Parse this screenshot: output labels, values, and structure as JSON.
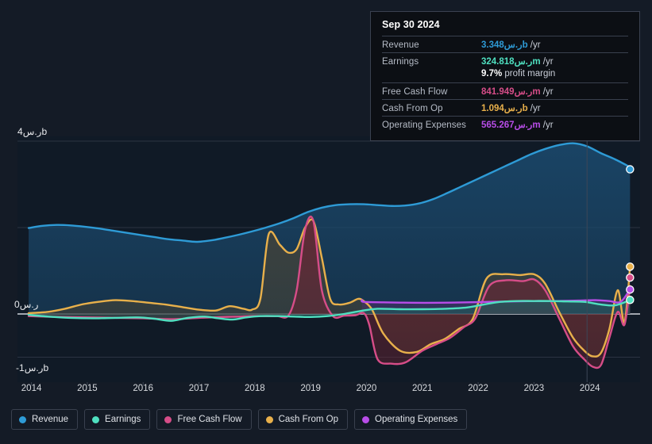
{
  "chart_data": {
    "type": "area",
    "title": "",
    "xlabel": "",
    "ylabel": "",
    "currency_symbol": "ر.س",
    "grid": true,
    "legend_position": "bottom",
    "xlim": [
      2013.75,
      2024.9
    ],
    "ylim": [
      -1.45,
      4.3
    ],
    "y_ticks": [
      {
        "value": 4,
        "label": "ر.س4b"
      },
      {
        "value": 0,
        "label": "ر.س0"
      },
      {
        "value": -1,
        "label": "-ر.س1b"
      }
    ],
    "x_ticks": [
      "2014",
      "2015",
      "2016",
      "2017",
      "2018",
      "2019",
      "2020",
      "2021",
      "2022",
      "2023",
      "2024"
    ],
    "units": "billions of ر.س (SAR)",
    "series": [
      {
        "name": "Revenue",
        "color": "#2e9bd6",
        "fill": "#1b4a6e",
        "x": [
          2013.95,
          2014.2,
          2014.45,
          2014.7,
          2014.95,
          2015.2,
          2015.45,
          2015.7,
          2015.95,
          2016.2,
          2016.45,
          2016.7,
          2016.95,
          2017.2,
          2017.45,
          2017.7,
          2017.95,
          2018.2,
          2018.45,
          2018.7,
          2018.95,
          2019.2,
          2019.45,
          2019.7,
          2019.95,
          2020.2,
          2020.45,
          2020.7,
          2020.95,
          2021.2,
          2021.45,
          2021.7,
          2021.95,
          2022.2,
          2022.45,
          2022.7,
          2022.95,
          2023.2,
          2023.45,
          2023.7,
          2023.95,
          2024.2,
          2024.45,
          2024.72
        ],
        "values": [
          1.99,
          2.04,
          2.06,
          2.05,
          2.02,
          1.98,
          1.93,
          1.88,
          1.83,
          1.78,
          1.73,
          1.7,
          1.67,
          1.7,
          1.76,
          1.83,
          1.91,
          2.0,
          2.1,
          2.22,
          2.36,
          2.46,
          2.52,
          2.54,
          2.54,
          2.52,
          2.5,
          2.51,
          2.56,
          2.66,
          2.8,
          2.95,
          3.1,
          3.25,
          3.4,
          3.55,
          3.7,
          3.82,
          3.91,
          3.95,
          3.88,
          3.72,
          3.58,
          3.4
        ]
      },
      {
        "name": "Earnings",
        "color": "#4fe0c0",
        "fill": "#1f5e58",
        "x": [
          2013.95,
          2014.3,
          2014.7,
          2015.1,
          2015.5,
          2015.9,
          2016.2,
          2016.5,
          2016.8,
          2017.1,
          2017.35,
          2017.6,
          2017.85,
          2018.1,
          2018.4,
          2018.7,
          2019.0,
          2019.3,
          2019.6,
          2019.9,
          2020.2,
          2020.6,
          2021.0,
          2021.4,
          2021.8,
          2022.1,
          2022.4,
          2022.7,
          2023.0,
          2023.3,
          2023.6,
          2023.9,
          2024.2,
          2024.45,
          2024.72
        ],
        "values": [
          -0.02,
          -0.06,
          -0.09,
          -0.1,
          -0.09,
          -0.08,
          -0.11,
          -0.16,
          -0.09,
          -0.06,
          -0.1,
          -0.13,
          -0.08,
          -0.05,
          -0.05,
          -0.06,
          -0.07,
          -0.05,
          0.0,
          0.07,
          0.12,
          0.11,
          0.11,
          0.12,
          0.15,
          0.22,
          0.28,
          0.3,
          0.3,
          0.3,
          0.29,
          0.28,
          0.22,
          0.2,
          0.32
        ]
      },
      {
        "name": "Free Cash Flow",
        "color": "#d64d88",
        "fill": "#6b2333",
        "x": [
          2013.95,
          2014.5,
          2015.0,
          2015.5,
          2016.0,
          2016.5,
          2017.0,
          2017.4,
          2017.75,
          2017.95,
          2018.15,
          2018.4,
          2018.6,
          2018.75,
          2018.9,
          2019.05,
          2019.2,
          2019.4,
          2019.6,
          2019.8,
          2019.95,
          2020.05,
          2020.2,
          2020.45,
          2020.7,
          2021.0,
          2021.25,
          2021.5,
          2021.75,
          2021.95,
          2022.2,
          2022.5,
          2022.8,
          2023.0,
          2023.2,
          2023.45,
          2023.7,
          2023.9,
          2024.05,
          2024.2,
          2024.35,
          2024.5,
          2024.62,
          2024.72
        ],
        "values": [
          -0.05,
          -0.07,
          -0.08,
          -0.09,
          -0.1,
          -0.12,
          -0.09,
          -0.07,
          -0.06,
          -0.05,
          -0.05,
          -0.05,
          -0.04,
          0.55,
          1.95,
          2.15,
          0.55,
          -0.05,
          -0.04,
          -0.03,
          0.02,
          -0.25,
          -1.05,
          -1.15,
          -1.12,
          -0.85,
          -0.7,
          -0.55,
          -0.3,
          -0.1,
          0.65,
          0.78,
          0.76,
          0.8,
          0.55,
          -0.1,
          -0.75,
          -1.05,
          -1.22,
          -1.18,
          -0.55,
          0.05,
          -0.25,
          0.65
        ]
      },
      {
        "name": "Cash From Op",
        "color": "#e8b04b",
        "fill": "#4a4434",
        "x": [
          2013.95,
          2014.3,
          2014.6,
          2014.9,
          2015.2,
          2015.5,
          2015.8,
          2016.1,
          2016.4,
          2016.7,
          2017.0,
          2017.3,
          2017.55,
          2017.8,
          2017.95,
          2018.1,
          2018.25,
          2018.45,
          2018.6,
          2018.75,
          2018.9,
          2019.05,
          2019.2,
          2019.35,
          2019.5,
          2019.7,
          2019.85,
          2019.95,
          2020.1,
          2020.3,
          2020.6,
          2020.9,
          2021.15,
          2021.4,
          2021.65,
          2021.9,
          2022.15,
          2022.45,
          2022.75,
          2023.0,
          2023.2,
          2023.45,
          2023.7,
          2023.9,
          2024.05,
          2024.2,
          2024.35,
          2024.5,
          2024.62,
          2024.72
        ],
        "values": [
          0.02,
          0.05,
          0.12,
          0.22,
          0.28,
          0.32,
          0.3,
          0.26,
          0.22,
          0.16,
          0.1,
          0.08,
          0.18,
          0.12,
          0.1,
          0.35,
          1.85,
          1.6,
          1.42,
          1.5,
          2.0,
          2.15,
          1.3,
          0.35,
          0.22,
          0.26,
          0.35,
          0.3,
          0.1,
          -0.45,
          -0.85,
          -0.88,
          -0.7,
          -0.58,
          -0.35,
          -0.12,
          0.82,
          0.92,
          0.9,
          0.92,
          0.7,
          0.05,
          -0.55,
          -0.85,
          -0.98,
          -0.9,
          -0.35,
          0.55,
          -0.2,
          1.09
        ]
      },
      {
        "name": "Operating Expenses",
        "color": "#b84de8",
        "fill": "#4a2f6b",
        "x": [
          2019.92,
          2019.95,
          2020.3,
          2020.8,
          2021.3,
          2021.8,
          2022.2,
          2022.6,
          2023.0,
          2023.4,
          2023.8,
          2024.1,
          2024.35,
          2024.55,
          2024.72
        ],
        "values": [
          0.32,
          0.28,
          0.27,
          0.26,
          0.26,
          0.27,
          0.28,
          0.29,
          0.3,
          0.3,
          0.31,
          0.32,
          0.3,
          0.28,
          0.57
        ]
      }
    ],
    "endpoint_markers": [
      {
        "name": "Revenue",
        "x": 2024.72,
        "value": 3.348,
        "color": "#2e9bd6"
      },
      {
        "name": "Cash From Op",
        "x": 2024.72,
        "value": 1.094,
        "color": "#e8b04b"
      },
      {
        "name": "Free Cash Flow",
        "x": 2024.72,
        "value": 0.842,
        "color": "#d64d88"
      },
      {
        "name": "Operating Expenses",
        "x": 2024.72,
        "value": 0.565,
        "color": "#b84de8"
      },
      {
        "name": "Earnings",
        "x": 2024.72,
        "value": 0.325,
        "color": "#4fe0c0"
      }
    ]
  },
  "tooltip": {
    "title": "Sep 30 2024",
    "rows": [
      {
        "label": "Revenue",
        "value": "3.348ر.سb",
        "unit": "/yr",
        "color": "#2e9bd6"
      },
      {
        "label": "Earnings",
        "value": "324.818ر.سm",
        "unit": "/yr",
        "color": "#4fe0c0"
      },
      {
        "label": "Free Cash Flow",
        "value": "841.949ر.سm",
        "unit": "/yr",
        "color": "#d64d88"
      },
      {
        "label": "Cash From Op",
        "value": "1.094ر.سb",
        "unit": "/yr",
        "color": "#e8b04b"
      },
      {
        "label": "Operating Expenses",
        "value": "565.267ر.سm",
        "unit": "/yr",
        "color": "#b84de8"
      }
    ],
    "margin_value": "9.7%",
    "margin_label": "profit margin"
  },
  "legend": {
    "items": [
      {
        "label": "Revenue",
        "color": "#2e9bd6"
      },
      {
        "label": "Earnings",
        "color": "#4fe0c0"
      },
      {
        "label": "Free Cash Flow",
        "color": "#d64d88"
      },
      {
        "label": "Cash From Op",
        "color": "#e8b04b"
      },
      {
        "label": "Operating Expenses",
        "color": "#b84de8"
      }
    ]
  },
  "theme": {
    "background": "#141b26",
    "plot_background": "#0f1722",
    "grid_color": "#2b3442",
    "zero_line_color": "#cfd4db",
    "text_color": "#dfe2e7"
  }
}
